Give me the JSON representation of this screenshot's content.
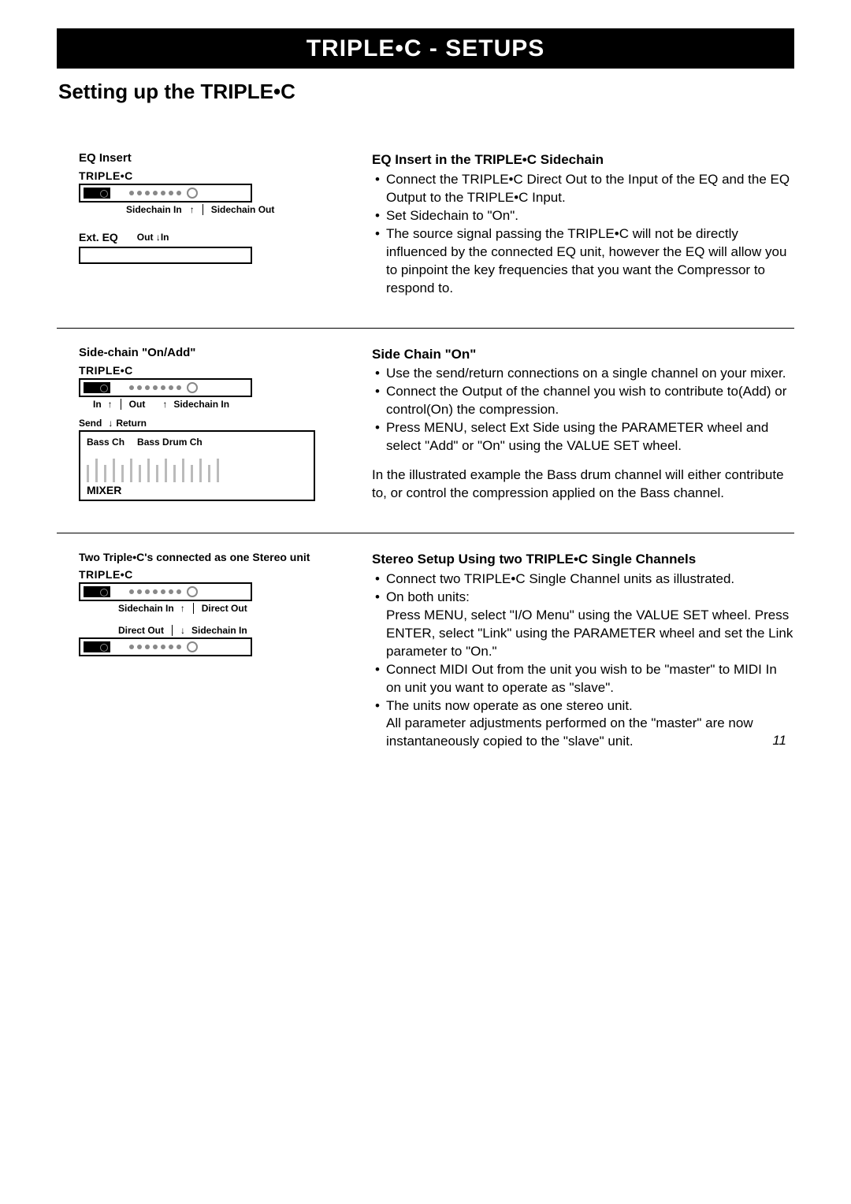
{
  "banner": "TRIPLE•C - SETUPS",
  "section_title": "Setting up the TRIPLE•C",
  "page_number": "11",
  "s1": {
    "diagram_title": "EQ Insert",
    "unit_label": "TRIPLE•C",
    "conn_left": "Sidechain In",
    "conn_right": "Sidechain Out",
    "ext_label": "Ext. EQ",
    "ext_out": "Out",
    "ext_in": "In",
    "heading": "EQ Insert in the TRIPLE•C Sidechain",
    "b1": "Connect the TRIPLE•C Direct Out to the Input of the EQ and the EQ Output to the TRIPLE•C Input.",
    "b2": "Set Sidechain to \"On\".",
    "b3": "The source signal passing the TRIPLE•C will not be directly influenced by the connected EQ unit, however the EQ will allow you to pinpoint the key frequencies that you want the Compressor to respond to."
  },
  "s2": {
    "diagram_title": "Side-chain \"On/Add\"",
    "unit_label": "TRIPLE•C",
    "conn_in": "In",
    "conn_out": "Out",
    "conn_sc": "Sidechain In",
    "send": "Send",
    "return": "Return",
    "ch1": "Bass Ch",
    "ch2": "Bass Drum Ch",
    "mixer": "MIXER",
    "heading": "Side Chain \"On\"",
    "b1": "Use the send/return connections on a single channel on your mixer.",
    "b2": "Connect the Output of the channel you wish to contribute to(Add) or control(On) the compression.",
    "b3": "Press MENU, select Ext Side using the PARAMETER wheel and select \"Add\" or \"On\" using the VALUE SET wheel.",
    "para": "In the illustrated example the Bass drum channel will either contribute to, or control the compression applied on the Bass channel."
  },
  "s3": {
    "diagram_title": "Two Triple•C's connected as one Stereo unit",
    "unit_label": "TRIPLE•C",
    "conn_top_left": "Sidechain In",
    "conn_top_right": "Direct Out",
    "conn_bot_left": "Direct Out",
    "conn_bot_right": "Sidechain In",
    "heading": "Stereo Setup Using two TRIPLE•C Single Channels",
    "b1": "Connect two TRIPLE•C Single Channel units as illustrated.",
    "b2a": "On both units:",
    "b2b": "Press MENU, select \"I/O Menu\" using the VALUE SET wheel. Press ENTER, select \"Link\" using the PARAMETER wheel and set the Link parameter to \"On.\"",
    "b3": "Connect MIDI Out from the unit you wish to be \"master\" to MIDI In on unit you want to operate as \"slave\".",
    "b4a": "The units now operate as one stereo unit.",
    "b4b": "All parameter adjustments performed on the \"master\" are now  instantaneously copied to the \"slave\" unit."
  }
}
